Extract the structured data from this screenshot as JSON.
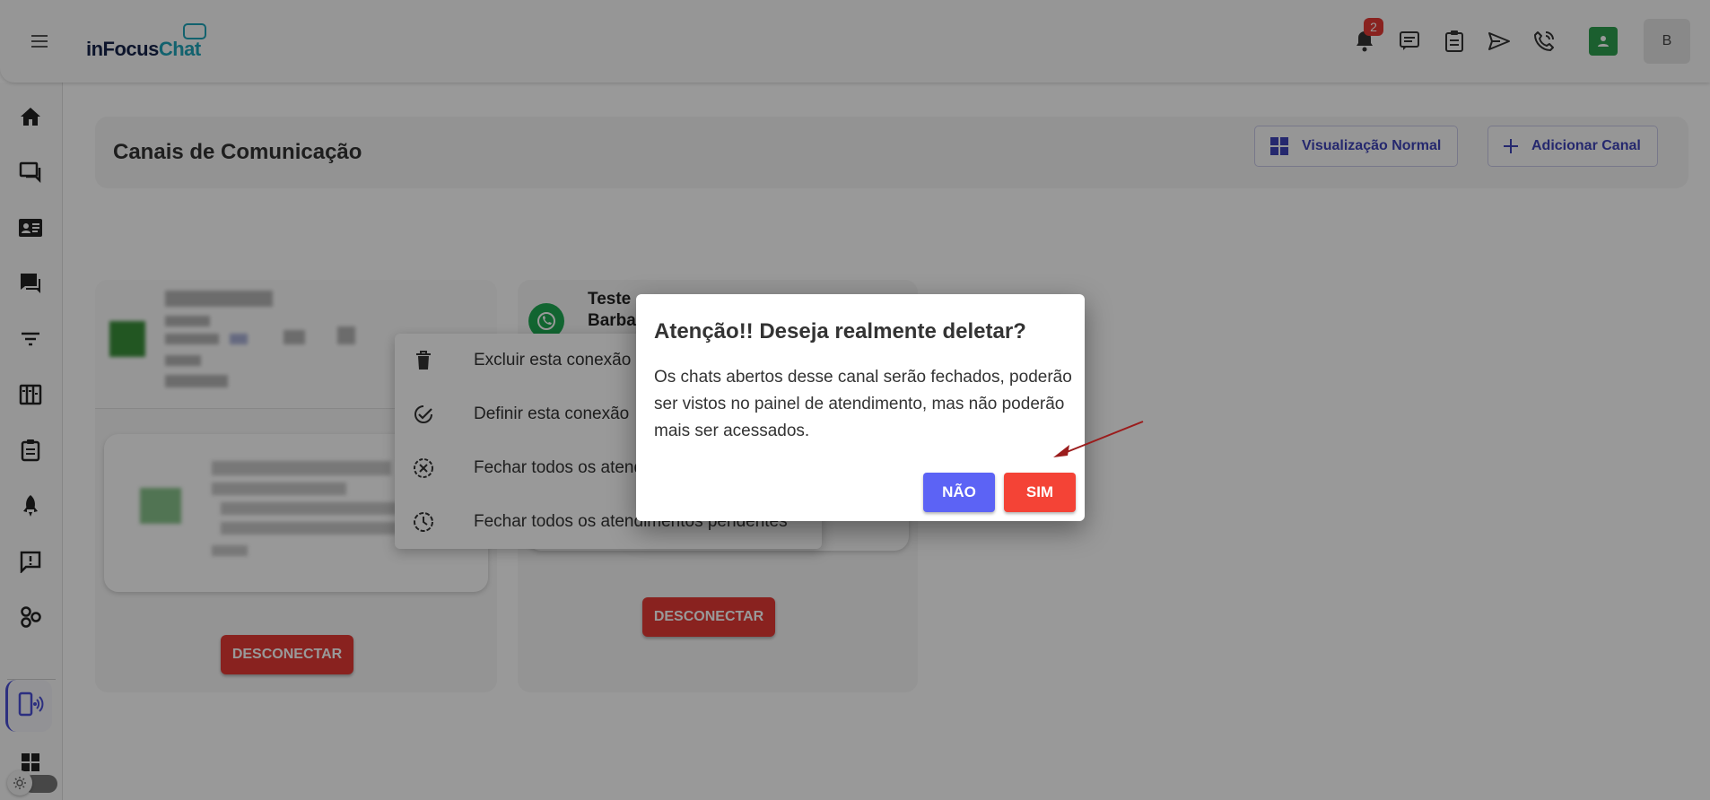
{
  "app": {
    "logo_part1": "inFocus",
    "logo_part2": "Chat"
  },
  "header": {
    "notification_count": "2",
    "avatar_initial": "B"
  },
  "page": {
    "title": "Canais de Comunicação",
    "view_button": "Visualização Normal",
    "add_button": "Adicionar Canal"
  },
  "cards": [
    {
      "disconnect_label": "DESCONECTAR"
    },
    {
      "name_line1": "Teste",
      "name_line2": "Barba",
      "disconnect_label": "DESCONECTAR"
    }
  ],
  "context_menu": {
    "items": [
      {
        "label": "Excluir esta conexão",
        "icon": "trash-icon"
      },
      {
        "label": "Definir esta conexão",
        "icon": "check-circle-icon"
      },
      {
        "label": "Fechar todos os atendimentos",
        "icon": "close-circle-icon"
      },
      {
        "label": "Fechar todos os atendimentos pendentes",
        "icon": "clock-icon"
      }
    ]
  },
  "dialog": {
    "title": "Atenção!! Deseja realmente deletar?",
    "body": "Os chats abertos desse canal serão fechados, poderão ser vistos no painel de atendimento, mas não poderão mais ser acessados.",
    "cancel_label": "NÃO",
    "confirm_label": "SIM"
  },
  "colors": {
    "primary": "#3f44b8",
    "danger": "#e53935",
    "confirm": "#f44336",
    "cancel": "#5c63f5",
    "whatsapp": "#1ea952",
    "arrow": "#9b1c1c"
  }
}
